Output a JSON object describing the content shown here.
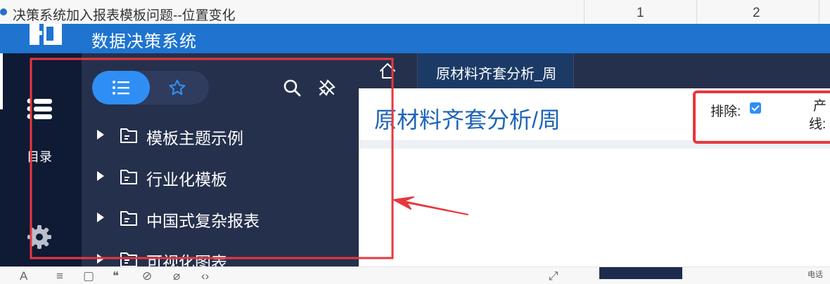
{
  "forum": {
    "post_title": "决策系统加入报表模板问题--位置变化",
    "col_1": "1",
    "col_2": "2"
  },
  "app": {
    "title": "数据决策系统",
    "brand_color": "#1e74cf"
  },
  "rail": {
    "catalog_label": "目录",
    "icons": [
      "list-icon",
      "gear-icon"
    ]
  },
  "panel": {
    "tabs": [
      "list-icon",
      "star-icon"
    ],
    "tools": [
      "search-icon",
      "pin-icon"
    ],
    "items": [
      {
        "label": "模板主题示例"
      },
      {
        "label": "行业化模板"
      },
      {
        "label": "中国式复杂报表"
      },
      {
        "label": "可视化图表"
      }
    ]
  },
  "tabs": {
    "active": "原材料齐套分析_周"
  },
  "report": {
    "title": "原材料齐套分析/周",
    "exclude_label": "排除:",
    "exclude_checked": true,
    "line_label_part1": "产",
    "line_label_part2": "线:"
  },
  "bottom_bar": {
    "phone_label": "电话"
  },
  "colors": {
    "panel_bg": "#25304c",
    "rail_bg": "#0f1a34",
    "accent": "#2f8ef4",
    "annotation": "#e8383d"
  }
}
